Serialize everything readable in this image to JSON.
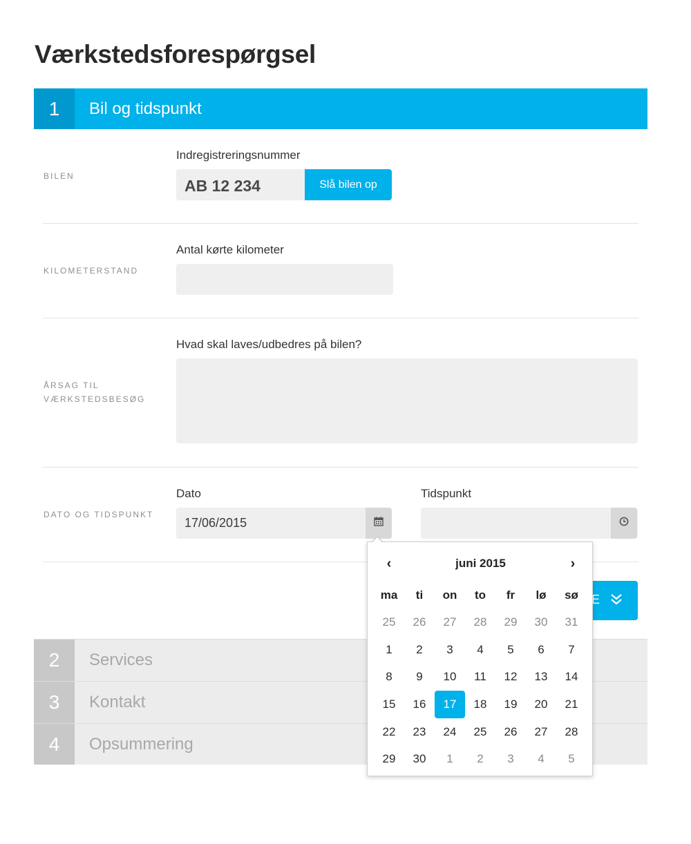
{
  "page": {
    "title": "Værkstedsforespørgsel"
  },
  "steps": [
    {
      "number": "1",
      "label": "Bil og tidspunkt"
    },
    {
      "number": "2",
      "label": "Services"
    },
    {
      "number": "3",
      "label": "Kontakt"
    },
    {
      "number": "4",
      "label": "Opsummering"
    }
  ],
  "car": {
    "row_label": "Bilen",
    "field_label": "Indregistreringsnummer",
    "plate_value": "AB 12 234",
    "lookup_button": "Slå bilen op"
  },
  "mileage": {
    "row_label": "Kilometerstand",
    "field_label": "Antal kørte kilometer",
    "value": ""
  },
  "reason": {
    "row_label_line1": "Årsag til",
    "row_label_line2": "værkstedsbesøg",
    "field_label": "Hvad skal laves/udbedres på bilen?",
    "value": ""
  },
  "datetime": {
    "row_label": "Dato og tidspunkt",
    "date_label": "Dato",
    "date_value": "17/06/2015",
    "time_label": "Tidspunkt",
    "time_value": "",
    "date_icon": "calendar-icon",
    "time_icon": "clock-icon"
  },
  "next_button": {
    "label": "E",
    "icon": "double-chevron-down-icon"
  },
  "datepicker": {
    "prev": "‹",
    "next": "›",
    "title": "juni 2015",
    "weekdays": [
      "ma",
      "ti",
      "on",
      "to",
      "fr",
      "lø",
      "sø"
    ],
    "weeks": [
      [
        "25",
        "26",
        "27",
        "28",
        "29",
        "30",
        "31"
      ],
      [
        "1",
        "2",
        "3",
        "4",
        "5",
        "6",
        "7"
      ],
      [
        "8",
        "9",
        "10",
        "11",
        "12",
        "13",
        "14"
      ],
      [
        "15",
        "16",
        "17",
        "18",
        "19",
        "20",
        "21"
      ],
      [
        "22",
        "23",
        "24",
        "25",
        "26",
        "27",
        "28"
      ],
      [
        "29",
        "30",
        "1",
        "2",
        "3",
        "4",
        "5"
      ]
    ],
    "selected_day": "17"
  },
  "colors": {
    "accent": "#00b1ea",
    "accent_dark": "#0098cf",
    "field_bg": "#efefef",
    "muted_step": "#c8c8c8"
  }
}
